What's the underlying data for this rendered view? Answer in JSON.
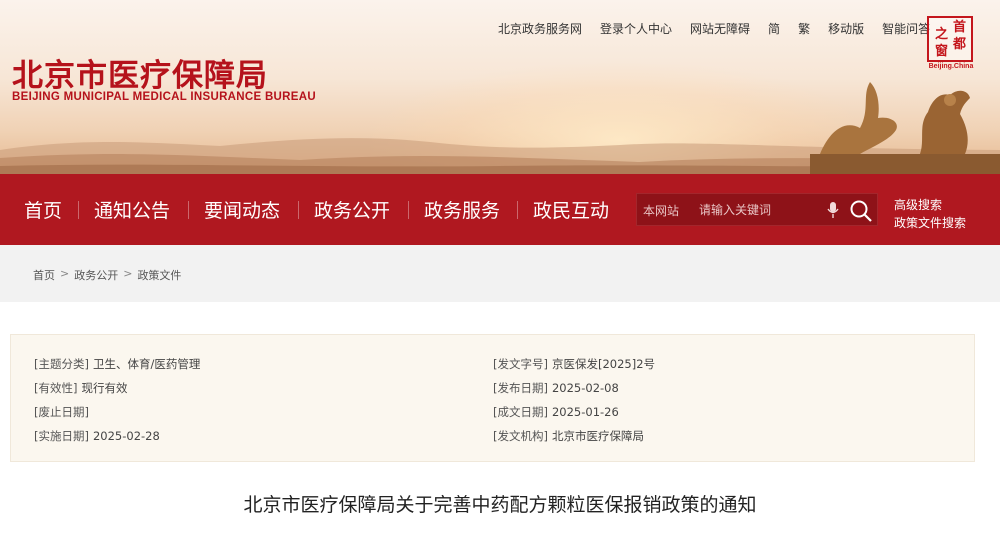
{
  "header": {
    "logo_cn": "北京市医疗保障局",
    "logo_en": "BEIJING MUNICIPAL MEDICAL INSURANCE BUREAU",
    "top_links": [
      "北京政务服务网",
      "登录个人中心",
      "网站无障碍",
      "简",
      "繁",
      "移动版",
      "智能问答"
    ],
    "seal": {
      "chars": [
        "首",
        "都",
        "之",
        "窗"
      ],
      "caption": "Beijing.China"
    }
  },
  "nav": {
    "items": [
      "首页",
      "通知公告",
      "要闻动态",
      "政务公开",
      "政务服务",
      "政民互动"
    ],
    "search_scope": "本网站",
    "search_placeholder": "请输入关键词",
    "advanced": [
      "高级搜索",
      "政策文件搜索"
    ]
  },
  "breadcrumb": [
    "首页",
    "政务公开",
    "政策文件"
  ],
  "meta": {
    "left": [
      {
        "label": "[主题分类]",
        "value": "卫生、体育/医药管理"
      },
      {
        "label": "[有效性]",
        "value": "现行有效"
      },
      {
        "label": "[废止日期]",
        "value": ""
      },
      {
        "label": "[实施日期]",
        "value": "2025-02-28"
      }
    ],
    "right": [
      {
        "label": "[发文字号]",
        "value": "京医保发[2025]2号"
      },
      {
        "label": "[发布日期]",
        "value": "2025-02-08"
      },
      {
        "label": "[成文日期]",
        "value": "2025-01-26"
      },
      {
        "label": "[发文机构]",
        "value": "北京市医疗保障局"
      }
    ]
  },
  "article": {
    "title": "北京市医疗保障局关于完善中药配方颗粒医保报销政策的通知"
  },
  "colors": {
    "brand_red": "#b01820",
    "logo_red": "#b5121b",
    "meta_bg": "#fbf7ef"
  }
}
